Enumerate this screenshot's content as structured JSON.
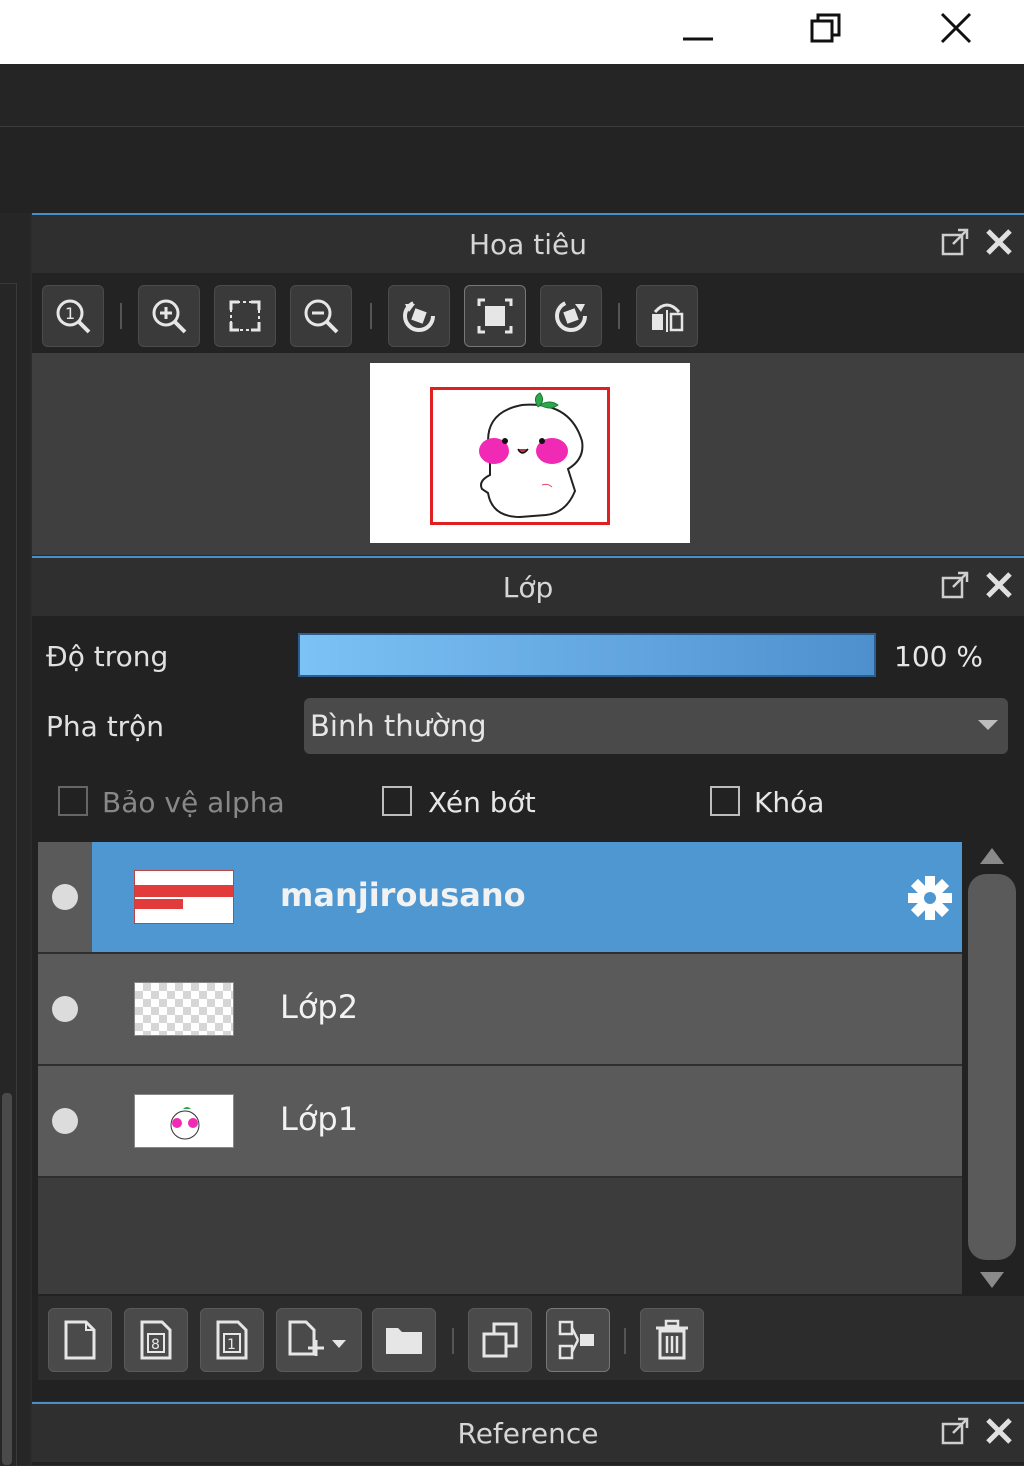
{
  "window": {
    "minimize_icon": "minimize-icon",
    "maximize_icon": "restore-icon",
    "close_icon": "close-icon"
  },
  "navigator": {
    "title": "Hoa tiêu",
    "tools": [
      "zoom-actual-icon",
      "zoom-in-icon",
      "fit-screen-icon",
      "zoom-out-icon",
      "rotate-left-icon",
      "reset-view-icon",
      "rotate-right-icon",
      "flip-icon"
    ]
  },
  "layer_panel": {
    "title": "Lớp",
    "opacity_label": "Độ trong",
    "opacity_value": "100 %",
    "opacity": 1.0,
    "blend_label": "Pha trộn",
    "blend_value": "Bình thường",
    "protect_alpha_label": "Bảo vệ alpha",
    "clip_label": "Xén bớt",
    "lock_label": "Khóa",
    "layers": [
      {
        "name": "manjirousano",
        "selected": true
      },
      {
        "name": "Lớp2",
        "selected": false
      },
      {
        "name": "Lớp1",
        "selected": false
      }
    ],
    "tools": [
      "new-layer-icon",
      "new-8bit-layer-icon",
      "new-1bit-layer-icon",
      "add-layer-dropdown-icon",
      "folder-icon",
      "duplicate-icon",
      "merge-icon",
      "delete-icon"
    ]
  },
  "reference": {
    "title": "Reference"
  },
  "colors": {
    "accent": "#4f97d1",
    "selected_row": "#4f97d1"
  }
}
